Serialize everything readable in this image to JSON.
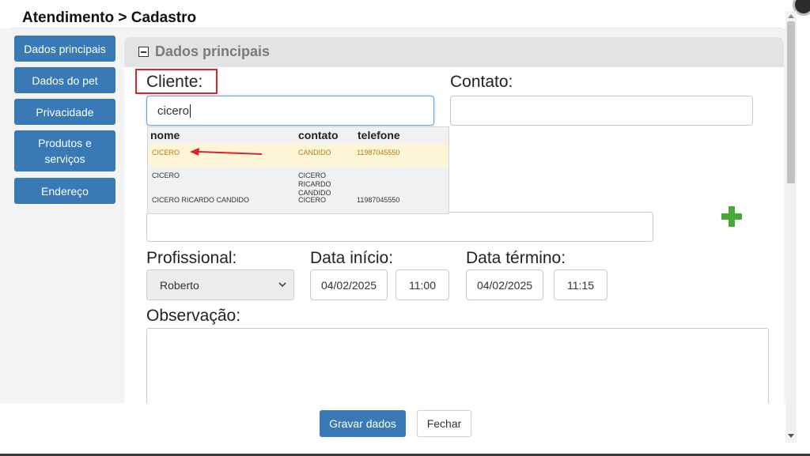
{
  "header": {
    "title": "Atendimento > Cadastro"
  },
  "sidebar": {
    "items": [
      {
        "label": "Dados principais"
      },
      {
        "label": "Dados do pet"
      },
      {
        "label": "Privacidade"
      },
      {
        "label": "Produtos e serviços"
      },
      {
        "label": "Endereço"
      }
    ]
  },
  "section": {
    "title": "Dados principais",
    "toggle_icon": "collapse-square-icon"
  },
  "form": {
    "cliente_label": "Cliente:",
    "cliente_value": "cicero",
    "contato_label": "Contato:",
    "contato_value": "",
    "profissional_label": "Profissional:",
    "profissional_value": "Roberto",
    "data_inicio_label": "Data início:",
    "data_inicio_value": "04/02/2025",
    "hora_inicio_value": "11:00",
    "data_termino_label": "Data término:",
    "data_termino_value": "04/02/2025",
    "hora_termino_value": "11:15",
    "observacao_label": "Observação:",
    "observacao_value": ""
  },
  "autocomplete": {
    "headers": {
      "nome": "nome",
      "contato": "contato",
      "telefone": "telefone"
    },
    "rows": [
      {
        "nome": "CICERO",
        "contato": "CANDIDO",
        "telefone": "11987045550",
        "highlighted": true
      },
      {
        "nome": "CICERO",
        "contato": "CICERO RICARDO CANDIDO",
        "telefone": "",
        "highlighted": false
      },
      {
        "nome": "CICERO RICARDO CANDIDO",
        "contato": "CICERO",
        "telefone": "11987045550",
        "highlighted": false
      }
    ]
  },
  "footer": {
    "save_label": "Gravar dados",
    "close_label": "Fechar"
  },
  "icons": {
    "add": "plus-icon",
    "select_chevron": "chevron-down-icon",
    "annotation": "red-arrow-icon"
  },
  "colors": {
    "primary": "#3879b6",
    "highlight_bg": "#fcf6d6",
    "highlight_text": "#b87a10",
    "annotation": "#d8242a",
    "add_icon": "#47a93a"
  }
}
